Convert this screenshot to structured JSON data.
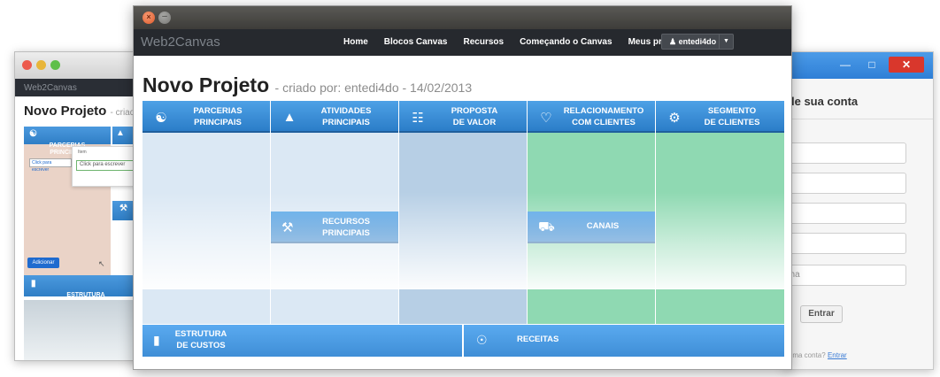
{
  "main_window": {
    "brand": "Web2Canvas",
    "nav": [
      "Home",
      "Blocos Canvas",
      "Recursos",
      "Começando o Canvas",
      "Meus projetos"
    ],
    "user": "entedi4do",
    "title": "Novo Projeto",
    "subtitle": "- criado por: entedi4do - 14/02/2013",
    "blocks": {
      "parcerias": "PARCERIAS\nPRINCIPAIS",
      "atividades": "ATIVIDADES\nPRINCIPAIS",
      "proposta": "PROPOSTA\nDE VALOR",
      "relacionamento": "RELACIONAMENTO\nCOM CLIENTES",
      "segmento": "SEGMENTO\nDE CLIENTES",
      "recursos": "RECURSOS\nPRINCIPAIS",
      "canais": "CANAIS",
      "custos": "ESTRUTURA\nDE CUSTOS",
      "receitas": "RECEITAS"
    },
    "colors": {
      "header_blue": "#2b7dc8",
      "col_light_blue": "#dbe8f4",
      "col_mid_blue": "#b7cfe5",
      "col_green": "#8fd9b2"
    }
  },
  "left_window": {
    "brand": "Web2Canvas",
    "title": "Novo Projeto",
    "subtitle": "- criad",
    "block_label": "PARCERIAS\nPRINCIPAIS",
    "popup_title": "Item",
    "popup_field": "Click para escrever",
    "small_input": "Click para escrever",
    "add_button": "Adicionar",
    "footer_block": "ESTRUTURA\nDE CUSTOS"
  },
  "right_window": {
    "heading": "le sua conta",
    "fields": [
      "e",
      "",
      "",
      "",
      "nha"
    ],
    "submit": "Entrar",
    "footer_text": "aui uma conta?",
    "footer_link": "Entrar"
  }
}
